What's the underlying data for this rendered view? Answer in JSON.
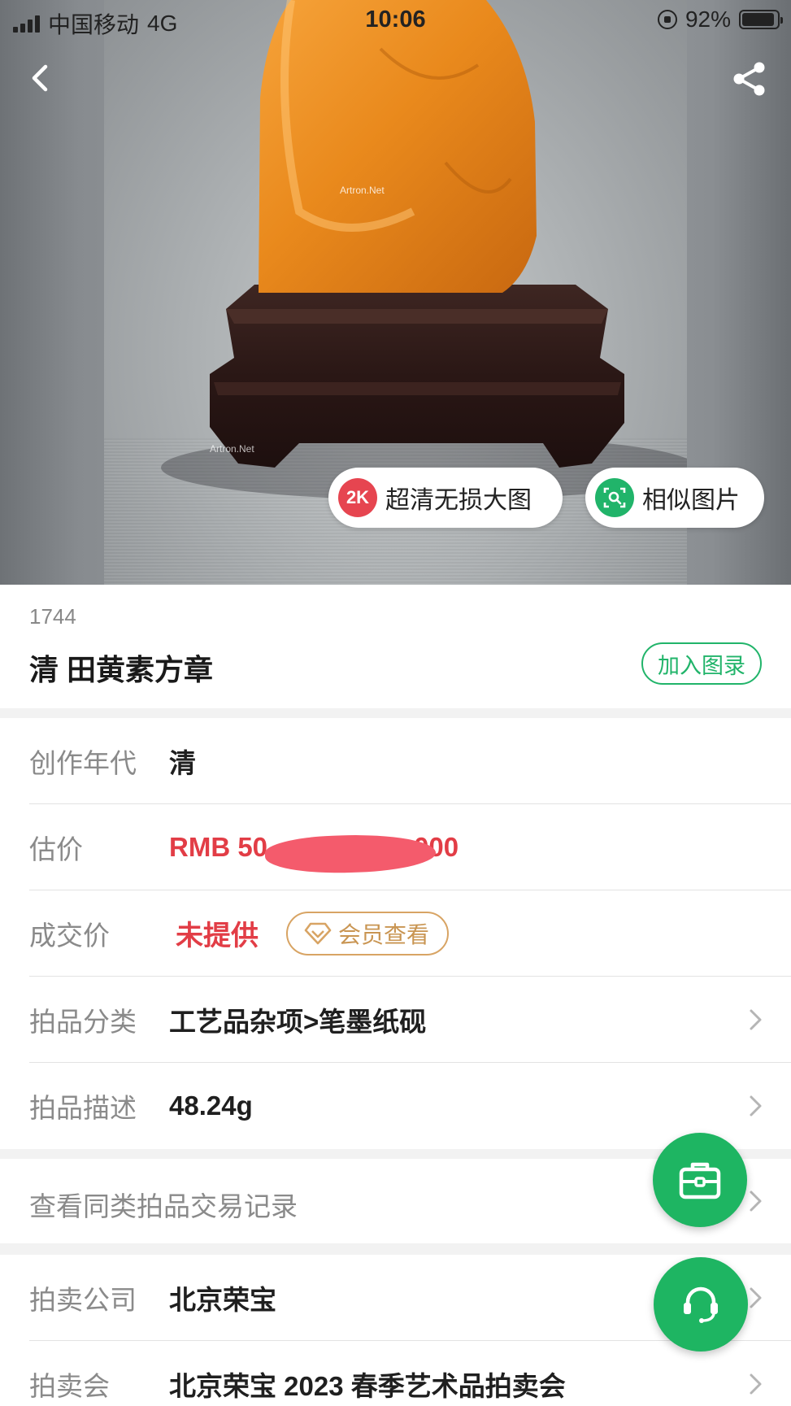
{
  "status_bar": {
    "carrier": "中国移动",
    "network": "4G",
    "time": "10:06",
    "battery": "92%",
    "battery_level": 0.92
  },
  "hero": {
    "watermark": "Artron.Net",
    "pill_hd": {
      "badge": "2K",
      "label": "超清无损大图"
    },
    "pill_similar": {
      "label": "相似图片"
    }
  },
  "lot": {
    "number": "1744",
    "title": "清 田黄素方章",
    "add_catalog": "加入图录"
  },
  "details": {
    "era": {
      "label": "创作年代",
      "value": "清"
    },
    "estimate": {
      "label": "估价",
      "value_prefix": "RMB  50",
      "value_suffix": "000"
    },
    "deal_price": {
      "label": "成交价",
      "value": "未提供",
      "member_btn": "会员查看"
    },
    "category": {
      "label": "拍品分类",
      "value": "工艺品杂项>笔墨纸砚"
    },
    "description": {
      "label": "拍品描述",
      "value": "48.24g"
    }
  },
  "records": {
    "label": "查看同类拍品交易记录"
  },
  "auction": {
    "company": {
      "label": "拍卖公司",
      "value": "北京荣宝"
    },
    "session": {
      "label": "拍卖会",
      "value": "北京荣宝 2023 春季艺术品拍卖会"
    }
  },
  "colors": {
    "accent_green": "#21b46a",
    "price_red": "#e23d46",
    "member_gold": "#d8a464"
  }
}
